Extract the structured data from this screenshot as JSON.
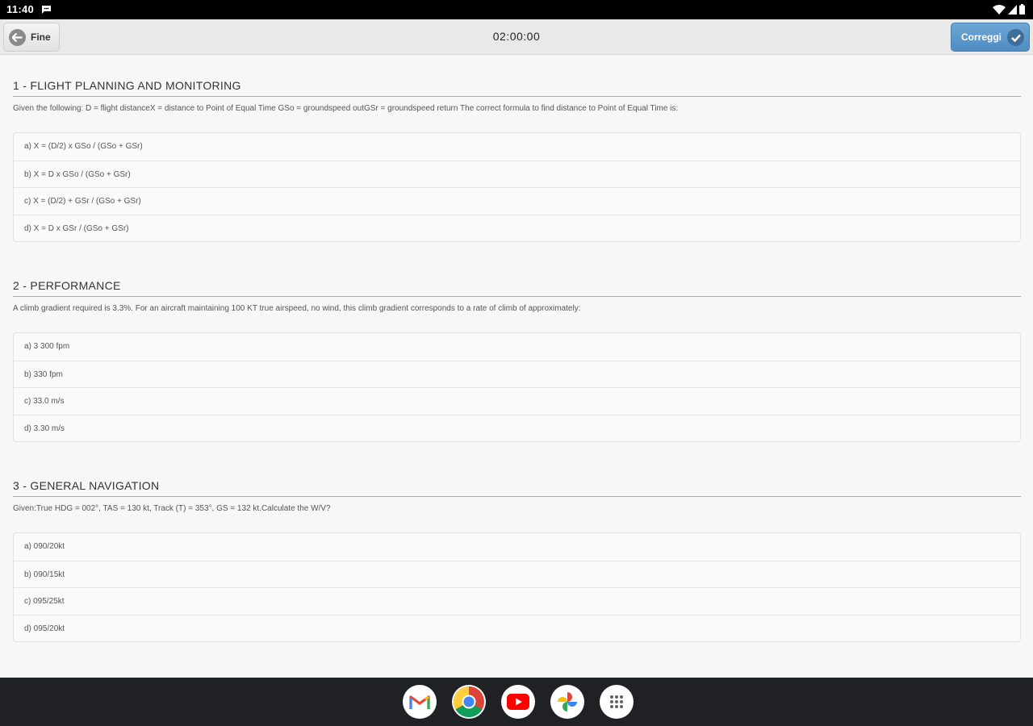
{
  "status_bar": {
    "time": "11:40"
  },
  "toolbar": {
    "back_label": "Fine",
    "timer": "02:00:00",
    "correct_label": "Correggi"
  },
  "questions": [
    {
      "title": "1 - FLIGHT PLANNING AND MONITORING",
      "text": "Given the following: D = flight distanceX = distance to Point of Equal Time GSo = groundspeed outGSr = groundspeed return The correct formula to find distance to Point of Equal Time is:",
      "options": [
        "a) X = (D/2) x GSo / (GSo + GSr)",
        "b) X = D x GSo / (GSo + GSr)",
        "c) X = (D/2) + GSr / (GSo + GSr)",
        "d) X = D x GSr / (GSo + GSr)"
      ]
    },
    {
      "title": "2 - PERFORMANCE",
      "text": "A climb gradient required is 3.3%. For an aircraft maintaining 100 KT true airspeed, no wind, this climb gradient corresponds to a rate of climb of approximately:",
      "options": [
        "a) 3 300 fpm",
        "b) 330 fpm",
        "c) 33.0 m/s",
        "d) 3.30 m/s"
      ]
    },
    {
      "title": "3 - GENERAL NAVIGATION",
      "text": "Given:True HDG = 002°, TAS = 130 kt, Track (T) = 353°, GS = 132 kt.Calculate the W/V?",
      "options": [
        "a) 090/20kt",
        "b) 090/15kt",
        "c) 095/25kt",
        "d) 095/20kt"
      ]
    }
  ],
  "dock": {
    "apps": [
      "gmail-icon",
      "chrome-icon",
      "youtube-icon",
      "photos-icon",
      "app-drawer-icon"
    ]
  }
}
